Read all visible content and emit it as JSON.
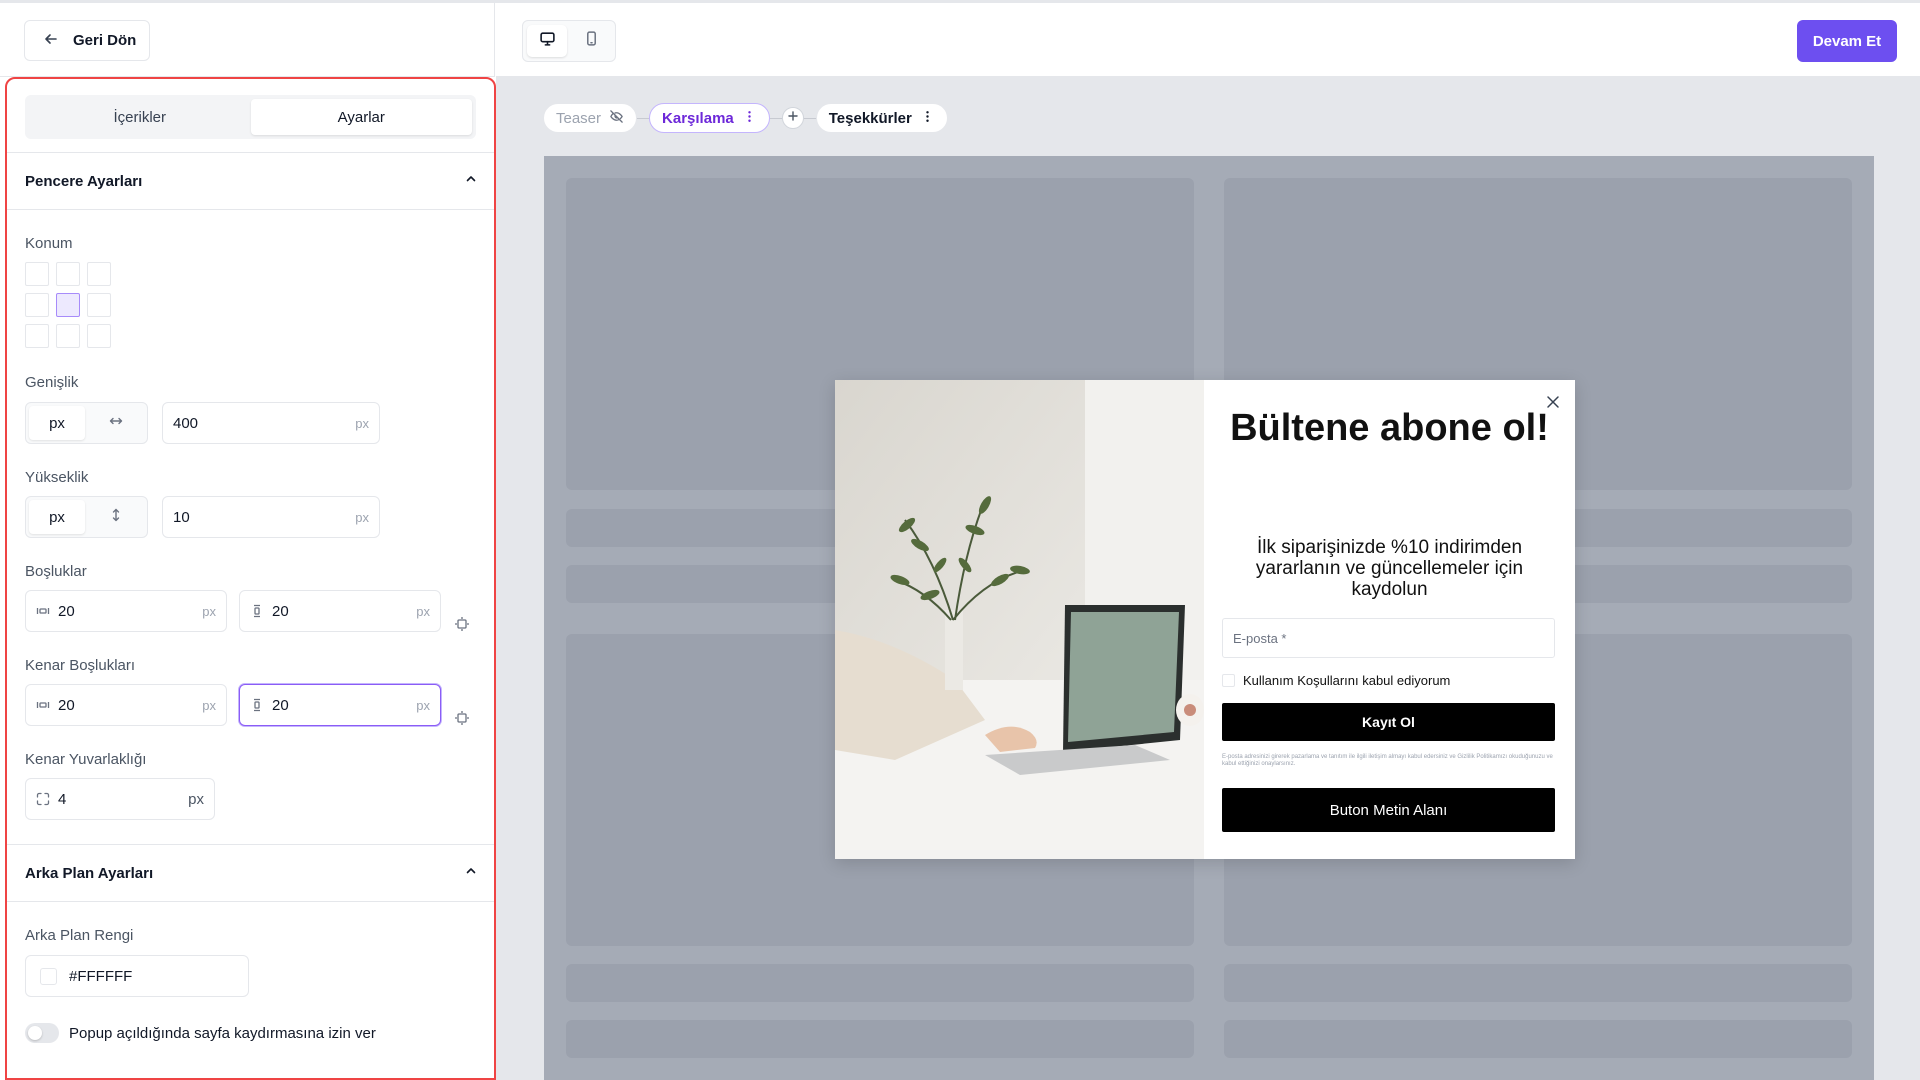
{
  "header": {
    "back_label": "Geri Dön",
    "continue_label": "Devam Et",
    "devices": [
      {
        "name": "desktop",
        "active": true
      },
      {
        "name": "mobile",
        "active": false
      }
    ]
  },
  "sidebar": {
    "tabs": [
      {
        "label": "İçerikler",
        "active": false
      },
      {
        "label": "Ayarlar",
        "active": true
      }
    ],
    "window_section": {
      "title": "Pencere Ayarları",
      "position_label": "Konum",
      "position_selected": "center",
      "width": {
        "label": "Genişlik",
        "unit_option": "px",
        "value": "400",
        "unit": "px"
      },
      "height": {
        "label": "Yükseklik",
        "unit_option": "px",
        "value": "10",
        "unit": "px"
      },
      "padding": {
        "label": "Boşluklar",
        "horizontal": "20",
        "vertical": "20",
        "unit": "px"
      },
      "margin": {
        "label": "Kenar Boşlukları",
        "horizontal": "20",
        "vertical": "20",
        "unit": "px"
      },
      "radius": {
        "label": "Kenar Yuvarlaklığı",
        "value": "4",
        "unit": "px"
      }
    },
    "background_section": {
      "title": "Arka Plan Ayarları",
      "color_label": "Arka Plan Rengi",
      "color_value": "#FFFFFF",
      "scroll_toggle_label": "Popup açıldığında sayfa kaydırmasına izin ver",
      "scroll_toggle_on": false
    }
  },
  "flow": {
    "steps": [
      {
        "label": "Teaser",
        "state": "hidden"
      },
      {
        "label": "Karşılama",
        "state": "active"
      },
      {
        "label": "Teşekkürler",
        "state": "normal"
      }
    ]
  },
  "popup": {
    "title": "Bültene abone ol!",
    "subtitle": "İlk siparişinizde %10 indirimden yararlanın ve güncellemeler için kaydolun",
    "email_placeholder": "E-posta *",
    "consent_label": "Kullanım Koşullarını kabul ediyorum",
    "submit_label": "Kayıt Ol",
    "legal_text": "E-posta adresinizi girerek pazarlama ve tanıtım ile ilgili iletişim almayı kabul edersiniz ve Gizlilik Politikamızı okuduğunuzu ve kabul ettiğinizi onaylarsınız.",
    "secondary_button_label": "Buton Metin Alanı"
  },
  "colors": {
    "accent": "#6d4ff0",
    "highlight_border": "#ef4444",
    "canvas_bg": "#e5e7eb",
    "stage_bg": "#a5abb6"
  }
}
